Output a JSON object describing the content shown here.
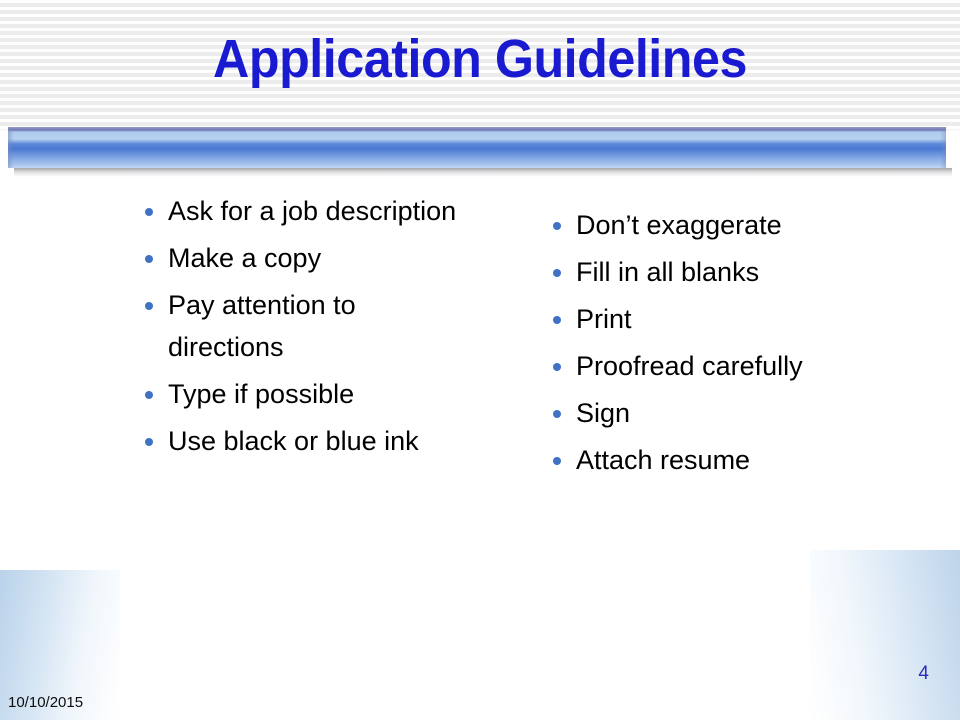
{
  "slide": {
    "title": "Application Guidelines",
    "title_color": "#1A1AD0",
    "accent_color": "#4A78D2",
    "bullet_color": "#3F72C4",
    "body_text_color": "#000000",
    "background_color": "#FFFFFF"
  },
  "columns": {
    "left": {
      "bullets": [
        {
          "text": "Ask for a job description"
        },
        {
          "text": "Make a copy"
        },
        {
          "text": "Pay attention to directions"
        },
        {
          "text": "Type if possible"
        },
        {
          "text": "Use black or blue ink"
        }
      ]
    },
    "right": {
      "bullets": [
        {
          "text": "Don’t exaggerate"
        },
        {
          "text": "Fill in all blanks"
        },
        {
          "text": "Print"
        },
        {
          "text": "Proofread carefully"
        },
        {
          "text": "Sign"
        },
        {
          "text": "Attach resume"
        }
      ]
    }
  },
  "footer": {
    "date": "10/10/2015",
    "page_number": "4",
    "page_number_color": "#2B2BBE"
  }
}
